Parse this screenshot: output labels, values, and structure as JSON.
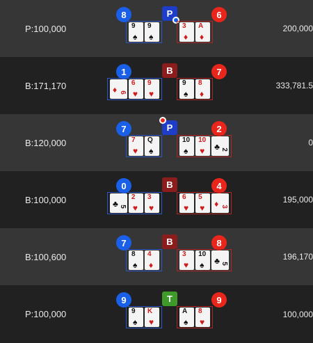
{
  "rows": [
    {
      "bet": "P:100,000",
      "win": "200,000",
      "player_total": "8",
      "result": "P",
      "banker_total": "6",
      "player_pair": false,
      "banker_pair": true,
      "player_cards": [
        {
          "rank": "9",
          "suit": "♠",
          "color": "black"
        },
        {
          "rank": "9",
          "suit": "♠",
          "color": "black"
        }
      ],
      "banker_cards": [
        {
          "rank": "3",
          "suit": "♦",
          "color": "red"
        },
        {
          "rank": "A",
          "suit": "♦",
          "color": "red"
        }
      ]
    },
    {
      "bet": "B:171,170",
      "win": "333,781.5",
      "player_total": "1",
      "result": "B",
      "banker_total": "7",
      "player_pair": false,
      "banker_pair": false,
      "player_cards": [
        {
          "rank": "6",
          "suit": "♦",
          "color": "red",
          "side": true
        },
        {
          "rank": "6",
          "suit": "♥",
          "color": "red"
        },
        {
          "rank": "9",
          "suit": "♥",
          "color": "red"
        }
      ],
      "banker_cards": [
        {
          "rank": "9",
          "suit": "♠",
          "color": "black"
        },
        {
          "rank": "8",
          "suit": "♦",
          "color": "red"
        }
      ]
    },
    {
      "bet": "B:120,000",
      "win": "0",
      "player_total": "7",
      "result": "P",
      "banker_total": "2",
      "player_pair": true,
      "banker_pair": false,
      "player_cards": [
        {
          "rank": "7",
          "suit": "♥",
          "color": "red"
        },
        {
          "rank": "Q",
          "suit": "♠",
          "color": "black"
        }
      ],
      "banker_cards": [
        {
          "rank": "10",
          "suit": "♠",
          "color": "black"
        },
        {
          "rank": "10",
          "suit": "♥",
          "color": "red"
        },
        {
          "rank": "2",
          "suit": "♣",
          "color": "black",
          "side": true
        }
      ]
    },
    {
      "bet": "B:100,000",
      "win": "195,000",
      "player_total": "0",
      "result": "B",
      "banker_total": "4",
      "player_pair": false,
      "banker_pair": false,
      "player_cards": [
        {
          "rank": "5",
          "suit": "♣",
          "color": "black",
          "side": true
        },
        {
          "rank": "2",
          "suit": "♥",
          "color": "red"
        },
        {
          "rank": "3",
          "suit": "♥",
          "color": "red"
        }
      ],
      "banker_cards": [
        {
          "rank": "6",
          "suit": "♥",
          "color": "red"
        },
        {
          "rank": "5",
          "suit": "♥",
          "color": "red"
        },
        {
          "rank": "3",
          "suit": "♦",
          "color": "red",
          "side": true
        }
      ]
    },
    {
      "bet": "B:100,600",
      "win": "196,170",
      "player_total": "7",
      "result": "B",
      "banker_total": "8",
      "player_pair": false,
      "banker_pair": false,
      "player_cards": [
        {
          "rank": "8",
          "suit": "♠",
          "color": "black"
        },
        {
          "rank": "4",
          "suit": "♦",
          "color": "red"
        }
      ],
      "banker_cards": [
        {
          "rank": "3",
          "suit": "♥",
          "color": "red"
        },
        {
          "rank": "10",
          "suit": "♠",
          "color": "black"
        },
        {
          "rank": "5",
          "suit": "♣",
          "color": "black",
          "side": true
        }
      ]
    },
    {
      "bet": "P:100,000",
      "win": "100,000",
      "player_total": "9",
      "result": "T",
      "banker_total": "9",
      "player_pair": false,
      "banker_pair": false,
      "player_cards": [
        {
          "rank": "9",
          "suit": "♠",
          "color": "black"
        },
        {
          "rank": "K",
          "suit": "♥",
          "color": "red"
        }
      ],
      "banker_cards": [
        {
          "rank": "A",
          "suit": "♠",
          "color": "black"
        },
        {
          "rank": "8",
          "suit": "♥",
          "color": "red"
        }
      ]
    }
  ]
}
